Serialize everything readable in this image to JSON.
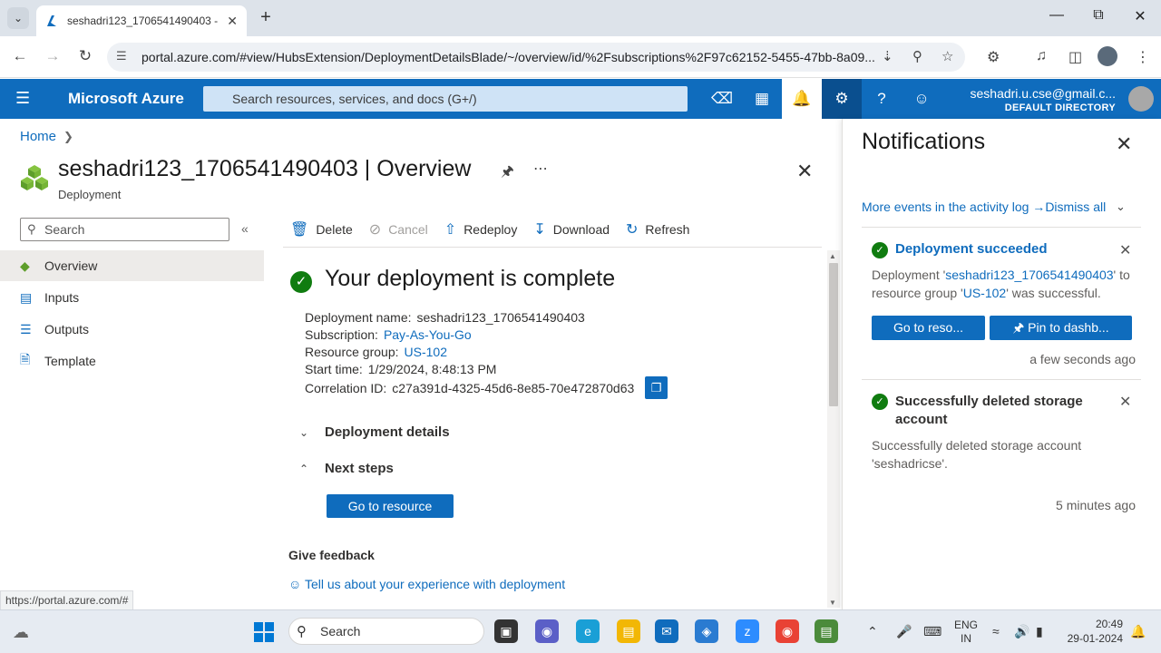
{
  "browser": {
    "tab_title": "seshadri123_1706541490403 - ",
    "url": "portal.azure.com/#view/HubsExtension/DeploymentDetailsBlade/~/overview/id/%2Fsubscriptions%2F97c62152-5455-47bb-8a09...",
    "status_url": "https://portal.azure.com/#"
  },
  "azure": {
    "brand": "Microsoft Azure",
    "search_placeholder": "Search resources, services, and docs (G+/)",
    "user_email": "seshadri.u.cse@gmail.c...",
    "directory": "DEFAULT DIRECTORY"
  },
  "blade": {
    "breadcrumb_home": "Home",
    "title": "seshadri123_1706541490403 | Overview",
    "subtitle": "Deployment",
    "left_search_placeholder": "Search",
    "nav": [
      {
        "label": "Overview",
        "icon": "overview-icon"
      },
      {
        "label": "Inputs",
        "icon": "inputs-icon"
      },
      {
        "label": "Outputs",
        "icon": "outputs-icon"
      },
      {
        "label": "Template",
        "icon": "template-icon"
      }
    ],
    "toolbar": {
      "delete": "Delete",
      "cancel": "Cancel",
      "redeploy": "Redeploy",
      "download": "Download",
      "refresh": "Refresh"
    },
    "heading": "Your deployment is complete",
    "details": {
      "name_label": "Deployment name:",
      "name_value": "seshadri123_1706541490403",
      "sub_label": "Subscription:",
      "sub_value": "Pay-As-You-Go",
      "rg_label": "Resource group:",
      "rg_value": "US-102",
      "start_label": "Start time:",
      "start_value": "1/29/2024, 8:48:13 PM",
      "corr_label": "Correlation ID:",
      "corr_value": "c27a391d-4325-45d6-8e85-70e472870d63"
    },
    "deployment_details": "Deployment details",
    "next_steps": "Next steps",
    "go_to_resource": "Go to resource",
    "give_feedback": "Give feedback",
    "feedback_link": "Tell us about your experience with deployment"
  },
  "notifications": {
    "title": "Notifications",
    "more_events": "More events in the activity log →",
    "dismiss_all": "Dismiss all",
    "items": [
      {
        "title": "Deployment succeeded",
        "body_prefix": "Deployment '",
        "body_link1": "seshadri123_1706541490403",
        "body_mid": "' to resource group '",
        "body_link2": "US-102",
        "body_suffix": "' was successful.",
        "btn1": "Go to reso...",
        "btn2": "Pin to dashb...",
        "time": "a few seconds ago"
      },
      {
        "title": "Successfully deleted storage account",
        "body": "Successfully deleted storage account 'seshadricse'.",
        "time": "5 minutes ago"
      }
    ]
  },
  "taskbar": {
    "search": "Search",
    "lang1": "ENG",
    "lang2": "IN",
    "time": "20:49",
    "date": "29-01-2024"
  }
}
